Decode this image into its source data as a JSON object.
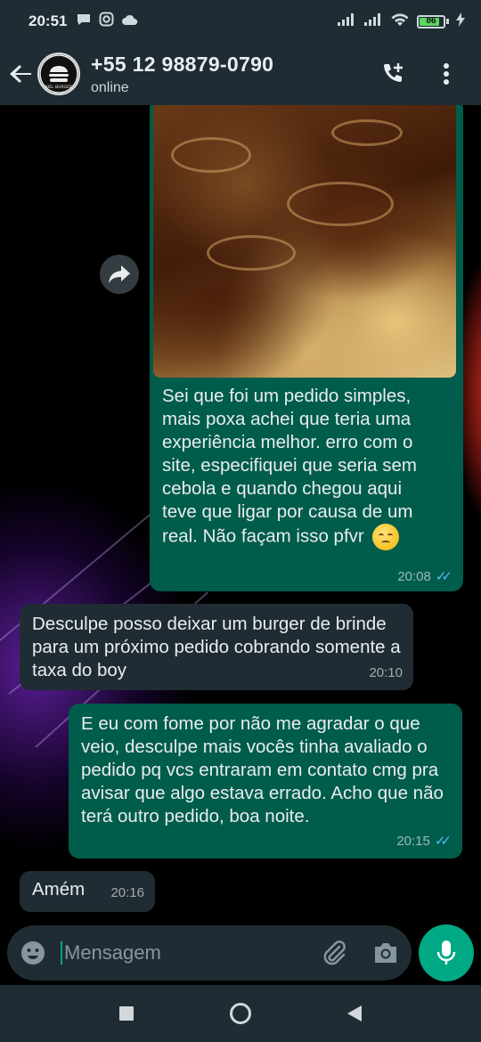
{
  "status_bar": {
    "time": "20:51",
    "battery": "86",
    "battery_level": 0.86
  },
  "header": {
    "contact_name": "+55 12 98879-0790",
    "contact_status": "online",
    "avatar_text": "KIEL BURGER"
  },
  "messages": {
    "m1": {
      "text_lines": [
        "Sei que foi um pedido simples,",
        "mais poxa achei que teria uma",
        "experiência melhor. erro com o",
        "site, especifiquei que seria sem",
        "cebola e quando chegou aqui",
        "teve que ligar por causa de um",
        "real. Não façam isso pfvr"
      ],
      "time": "20:08"
    },
    "m2": {
      "text": "Desculpe posso deixar um burger de brinde para um próximo pedido cobrando somente a taxa do boy",
      "time": "20:10"
    },
    "m3": {
      "text": "E eu com fome por não me agradar o que veio, desculpe mais vocês tinha avaliado o pedido pq vcs entraram em contato cmg pra avisar que algo estava errado. Acho que não terá outro pedido, boa noite.",
      "time": "20:15"
    },
    "m4": {
      "text": "Amém",
      "time": "20:16"
    }
  },
  "composer": {
    "placeholder": "Mensagem"
  },
  "colors": {
    "outgoing_bubble": "#005c4b",
    "incoming_bubble": "#202c33",
    "accent": "#00a884",
    "read_ticks": "#53bdeb"
  }
}
